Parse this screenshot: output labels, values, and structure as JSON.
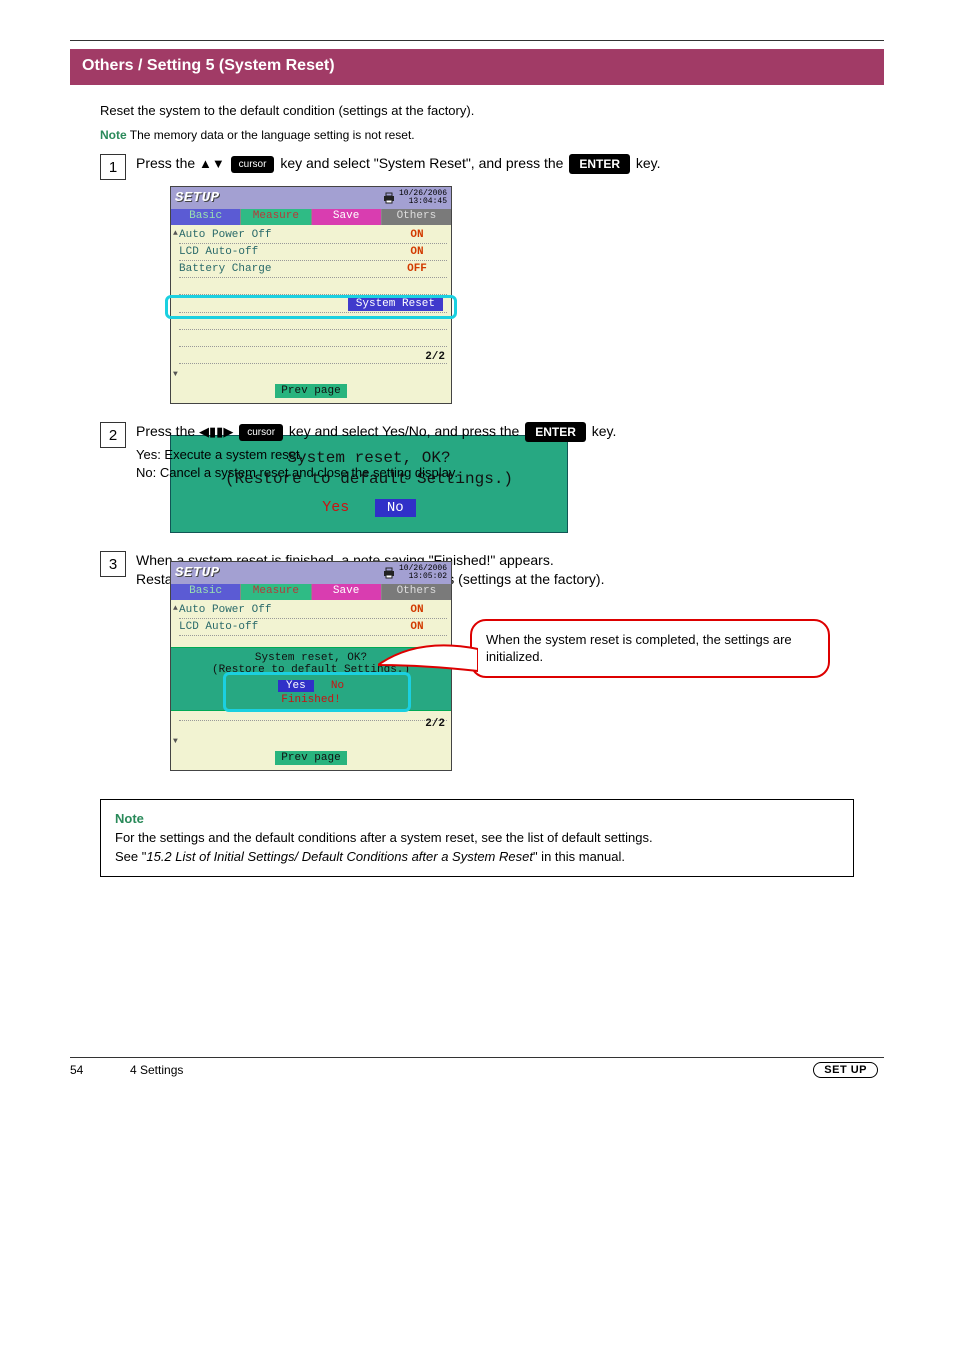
{
  "banner_title": "Others / Setting 5 (System Reset)",
  "intro": "Reset the system to the default condition (settings at the factory).",
  "note_head": "Note",
  "note_body": "The memory data or the language setting is not reset.",
  "steps": {
    "1": {
      "num": "1",
      "text_before": "Press the ",
      "cursor_label": "cursor",
      "text_mid": " key and select \"System Reset\", and press the ",
      "enter_label": "ENTER",
      "text_after": " key."
    },
    "2": {
      "num": "2",
      "last_left": "Press the ",
      "cursor_label": "cursor",
      "last_mid": " key and select Yes/No, and press the ",
      "enter_label": "ENTER",
      "last_after": " key.",
      "yes_line": "Yes: Execute a system reset.",
      "no_line": "No: Cancel a system reset and close the setting display."
    },
    "3": {
      "num": "3",
      "line1": "When a system reset is finished, a note saying \"Finished!\" appears.",
      "line2": "Restart and put the system in the default conditions (settings at the factory)."
    }
  },
  "shot": {
    "title": "SETUP",
    "time1": "10/26/2006",
    "time2": "13:04:45",
    "time3": "13:05:02",
    "tabs": {
      "basic": "Basic",
      "measure": "Measure",
      "save": "Save",
      "others": "Others"
    },
    "items": {
      "auto_power": {
        "label": "Auto Power Off",
        "value": "ON"
      },
      "lcd": {
        "label": "LCD Auto-off",
        "value": "ON"
      },
      "battery": {
        "label": "Battery Charge",
        "value": "OFF"
      }
    },
    "system_reset": "System Reset",
    "pager": "2/2",
    "prev": "Prev page"
  },
  "dialog": {
    "line1": "System reset, OK?",
    "line2": "(Restore to default Settings.)",
    "yes": "Yes",
    "no": "No",
    "finished": "Finished!"
  },
  "callout": "When the system reset is completed, the settings are initialized.",
  "notebox": {
    "head": "Note",
    "l1": "For the settings and the default conditions after a system reset, see the list of default settings.",
    "l2a": "See \"",
    "l2b": "15.2 List of Initial Settings/ Default Conditions after a System Reset",
    "l2c": "\" in this manual."
  },
  "footer": {
    "page": "54",
    "chapter": "4 Settings",
    "setup": "SET UP"
  }
}
